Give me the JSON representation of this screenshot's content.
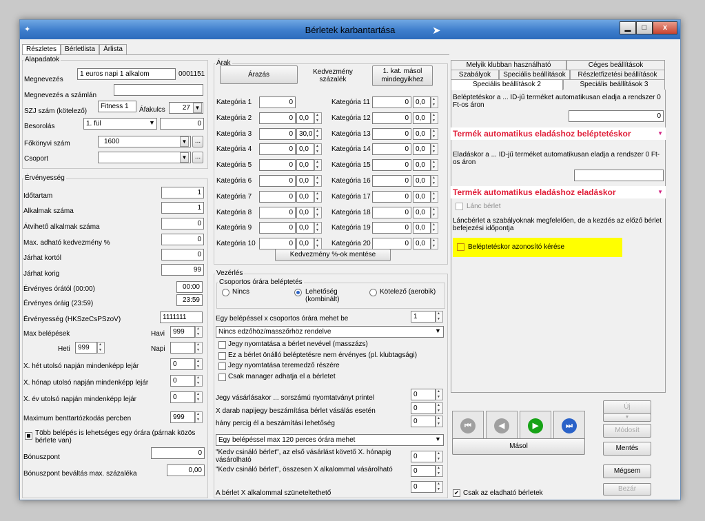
{
  "window": {
    "title": "Bérletek karbantartása",
    "minimize": "▁",
    "maximize": "□",
    "close": "x"
  },
  "tabs": [
    "Részletes",
    "Bérletlista",
    "Árlista"
  ],
  "alapadatok": {
    "legend": "Alapadatok",
    "megnevezes_label": "Megnevezés",
    "megnevezes_value": "1 euros napi 1 alkalom",
    "code": "0001151",
    "szamlan_label": "Megnevezés a számlán",
    "szamlan_value": "",
    "szj_label": "SZJ szám (kötelező)",
    "szj_value": "Fitness 1",
    "afa_label": "Áfakulcs",
    "afa_value": "27",
    "besorolas_label": "Besorolás",
    "besorolas_value": "1. fül",
    "besorolas_num": "0",
    "fokonyv_label": "Főkönyvi szám",
    "fokonyv_value": "1600",
    "csoport_label": "Csoport",
    "csoport_value": "",
    "ellipsis": "..."
  },
  "ervenyesseg": {
    "legend": "Érvényesség",
    "rows": [
      {
        "label": "Időtartam",
        "value": "1"
      },
      {
        "label": "Alkalmak száma",
        "value": "1"
      },
      {
        "label": "Átvihető alkalmak száma",
        "value": "0"
      },
      {
        "label": "Max. adható kedvezmény %",
        "value": "0"
      },
      {
        "label": "Járhat kortól",
        "value": "0"
      },
      {
        "label": "Járhat korig",
        "value": "99"
      }
    ],
    "oratol_label": "Érvényes órától (00:00)",
    "oratol_value": "00:00",
    "oraig_label": "Érvényes óráig (23:59)",
    "oraig_value": "23:59",
    "hk_label": "Érvényesség  (HKSzeCsPSzoV)",
    "hk_value": "1111111",
    "maxbel_label": "Max belépések",
    "havi_label": "Havi",
    "havi_value": "999",
    "heti_label": "Heti",
    "heti_value": "999",
    "napi_label": "Napi",
    "napi_value": "",
    "het_label": "X. hét utolsó napján mindenképp lejár",
    "het_value": "0",
    "honap_label": "X. hónap utolsó napján mindenképp lejár",
    "honap_value": "0",
    "ev_label": "X. év utolsó napján mindenképp lejár",
    "ev_value": "0",
    "benntart_label": "Maximum benttartózkodás percben",
    "benntart_value": "999",
    "tobb_label": "Több belépés is lehetséges egy órára (párnak közös bérlete van)",
    "bonusz_label": "Bónuszpont",
    "bonusz_value": "0",
    "bonuszmax_label": "Bónuszpont beváltás max. százaléka",
    "bonuszmax_value": "0,00"
  },
  "arak": {
    "legend": "Árak",
    "arazas": "Árazás",
    "kedv_label": "Kedvezmény százalék",
    "masol_btn": "1. kat. másol mindegyikhez",
    "left": [
      {
        "label": "Kategória 1",
        "value": "0",
        "pct": ""
      },
      {
        "label": "Kategória 2",
        "value": "0",
        "pct": "0,0"
      },
      {
        "label": "Kategória 3",
        "value": "0",
        "pct": "30,0"
      },
      {
        "label": "Kategória 4",
        "value": "0",
        "pct": "0,0"
      },
      {
        "label": "Kategória 5",
        "value": "0",
        "pct": "0,0"
      },
      {
        "label": "Kategória 6",
        "value": "0",
        "pct": "0,0"
      },
      {
        "label": "Kategória 7",
        "value": "0",
        "pct": "0,0"
      },
      {
        "label": "Kategória 8",
        "value": "0",
        "pct": "0,0"
      },
      {
        "label": "Kategória 9",
        "value": "0",
        "pct": "0,0"
      },
      {
        "label": "Kategória 10",
        "value": "0",
        "pct": "0,0"
      }
    ],
    "right": [
      {
        "label": "Kategória 11",
        "value": "0",
        "pct": "0,0"
      },
      {
        "label": "Kategória 12",
        "value": "0",
        "pct": "0,0"
      },
      {
        "label": "Kategória 13",
        "value": "0",
        "pct": "0,0"
      },
      {
        "label": "Kategória 14",
        "value": "0",
        "pct": "0,0"
      },
      {
        "label": "Kategória 15",
        "value": "0",
        "pct": "0,0"
      },
      {
        "label": "Kategória 16",
        "value": "0",
        "pct": "0,0"
      },
      {
        "label": "Kategória 17",
        "value": "0",
        "pct": "0,0"
      },
      {
        "label": "Kategória 18",
        "value": "0",
        "pct": "0,0"
      },
      {
        "label": "Kategória 19",
        "value": "0",
        "pct": "0,0"
      },
      {
        "label": "Kategória 20",
        "value": "0",
        "pct": "0,0"
      }
    ],
    "mentes_btn": "Kedvezmény %-ok mentése"
  },
  "vezerles": {
    "legend": "Vezérlés",
    "csop_legend": "Csoportos órára beléptetés",
    "nincs": "Nincs",
    "lehetoseg": "Lehetőség (kombinált)",
    "kotelezo": "Kötelező (aerobik)",
    "egybel_label": "Egy belépéssel x csoportos órára mehet be",
    "egybel_value": "1",
    "edzo_value": "Nincs edzőhöz/masszőrhöz rendelve",
    "checks": [
      "Jegy nyomtatása a bérlet nevével (masszázs)",
      "Ez a bérlet önálló beléptetésre nem érvényes (pl. klubtagsági)",
      "Jegy nyomtatása teremedző részére",
      "Csak manager adhatja el a bérletet"
    ],
    "vasarlas_label": "Jegy vásárlásakor ... sorszámú nyomtatványt printel",
    "vasarlas_value": "0",
    "xdarab_label": "X darab napijegy beszámítása bérlet vásálás esetén",
    "xdarab_value": "0",
    "hanyperc_label": "hány percig él a beszámítási lehetőség",
    "hanyperc_value": "0",
    "egy120_value": "Egy belépéssel max 120 perces órára mehet",
    "kedv1_label": "\"Kedv csináló bérlet\", az első vásárlást követő X. hónapig vásárolható",
    "kedv1_value": "0",
    "kedv2_label": "\"Kedv csináló bérlet\", összesen X alkalommal vásárolható",
    "kedv2_value": "0",
    "szunet_label": "A bérlet X alkalommal szüneteltethető",
    "szunet_value": "0"
  },
  "right": {
    "tabs_row1": [
      "Melyik klubban használható",
      "Céges beállítások"
    ],
    "tabs_row2": [
      "Szabályok",
      "Speciális beállítások",
      "Részletfizetési beállítások"
    ],
    "tabs_row3": [
      "Speciális beállítások 2",
      "Speciális beállítások 3"
    ],
    "belep_text": "Beléptetéskor a ... ID-jű terméket automatikusan eladja a rendszer 0 Ft-os áron",
    "belep_value": "0",
    "belep_bar": "Termék automatikus eladáshoz beléptetéskor",
    "elad_text": "Eladáskor a ... ID-jű terméket automatikusan eladja a rendszer 0 Ft-os áron",
    "elad_value": "",
    "elad_bar": "Termék automatikus eladáshoz eladáskor",
    "lanc_label": "Lánc bérlet",
    "lanc_text": "Láncbérlet a szabályoknak megfelelően, de a kezdés az előző bérlet befejezési időpontja",
    "azon_label": "Beléptetéskor azonosító kérése",
    "masol_btn": "Másol",
    "uj_btn": "Új",
    "modosit_btn": "Módosít",
    "mentes_btn": "Mentés",
    "megsem_btn": "Mégsem",
    "bezar_btn": "Bezár",
    "csak_label": "Csak az eladható bérletek"
  },
  "colors": {
    "highlight": "#ffff00",
    "red": "#e0203a",
    "nav_grey": "#a0a0a0",
    "nav_green": "#16a316",
    "nav_blue": "#2a62c8"
  }
}
